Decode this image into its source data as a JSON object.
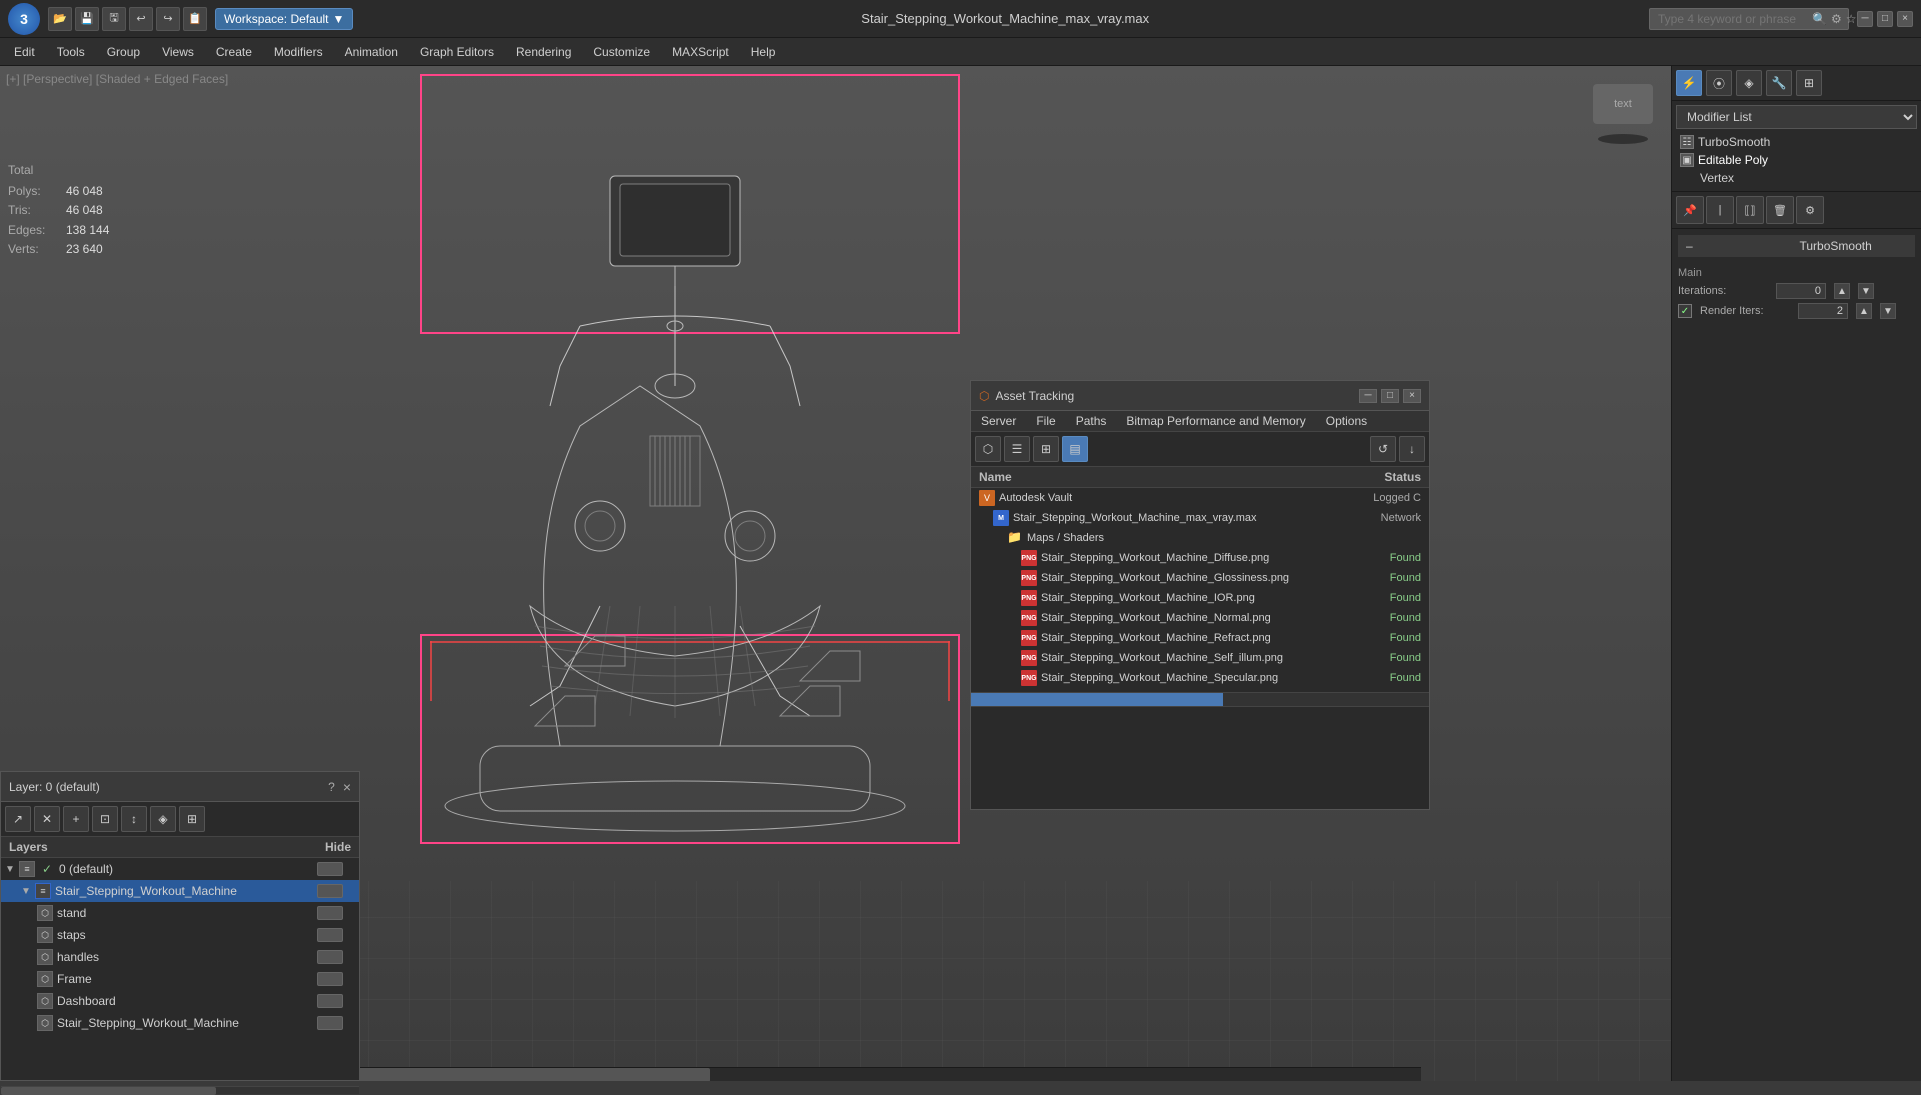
{
  "app": {
    "logo": "3",
    "title": "Stair_Stepping_Workout_Machine_max_vray.max",
    "workspace": "Workspace: Default"
  },
  "toolbar": {
    "buttons": [
      "💾",
      "📂",
      "🖫",
      "↩",
      "↪",
      "📋"
    ],
    "search_placeholder": "Type 4 keyword or phrase",
    "search_icons": [
      "🔍",
      "⚙",
      "★",
      "?"
    ]
  },
  "menu": {
    "items": [
      "Edit",
      "Tools",
      "Group",
      "Views",
      "Create",
      "Modifiers",
      "Animation",
      "Graph Editors",
      "Rendering",
      "Customize",
      "MAXScript",
      "Help"
    ]
  },
  "viewport": {
    "label": "[+] [Perspective] [Shaded + Edged Faces]",
    "stats": {
      "total_label": "Total",
      "polys_label": "Polys:",
      "polys_value": "46 048",
      "tris_label": "Tris:",
      "tris_value": "46 048",
      "edges_label": "Edges:",
      "edges_value": "138 144",
      "verts_label": "Verts:",
      "verts_value": "23 640"
    }
  },
  "right_panel": {
    "modifier_list_label": "Modifier List",
    "turbosmooth_label": "TurboSmooth",
    "editable_poly_label": "Editable Poly",
    "vertex_label": "Vertex",
    "section": {
      "title": "TurboSmooth",
      "main_label": "Main",
      "iterations_label": "Iterations:",
      "iterations_value": "0",
      "render_iters_label": "Render Iters:",
      "render_iters_value": "2"
    }
  },
  "layers_panel": {
    "title": "Layer: 0 (default)",
    "close_btn": "×",
    "help_btn": "?",
    "col_name": "Layers",
    "col_hide": "Hide",
    "items": [
      {
        "indent": 0,
        "name": "0 (default)",
        "type": "layer",
        "check": true,
        "expanded": true
      },
      {
        "indent": 1,
        "name": "Stair_Stepping_Workout_Machine",
        "type": "layer",
        "selected": true,
        "expanded": true
      },
      {
        "indent": 2,
        "name": "stand",
        "type": "object"
      },
      {
        "indent": 2,
        "name": "staps",
        "type": "object"
      },
      {
        "indent": 2,
        "name": "handles",
        "type": "object"
      },
      {
        "indent": 2,
        "name": "Frame",
        "type": "object"
      },
      {
        "indent": 2,
        "name": "Dashboard",
        "type": "object"
      },
      {
        "indent": 2,
        "name": "Stair_Stepping_Workout_Machine",
        "type": "object"
      }
    ]
  },
  "asset_panel": {
    "title": "Asset Tracking",
    "col_name": "Name",
    "col_status": "Status",
    "menu_items": [
      "Server",
      "File",
      "Paths",
      "Bitmap Performance and Memory",
      "Options"
    ],
    "items": [
      {
        "indent": 0,
        "type": "vault",
        "name": "Autodesk Vault",
        "status": "Logged C"
      },
      {
        "indent": 1,
        "type": "max",
        "name": "Stair_Stepping_Workout_Machine_max_vray.max",
        "status": "Network"
      },
      {
        "indent": 2,
        "type": "folder",
        "name": "Maps / Shaders",
        "status": ""
      },
      {
        "indent": 3,
        "type": "png",
        "name": "Stair_Stepping_Workout_Machine_Diffuse.png",
        "status": "Found"
      },
      {
        "indent": 3,
        "type": "png",
        "name": "Stair_Stepping_Workout_Machine_Glossiness.png",
        "status": "Found"
      },
      {
        "indent": 3,
        "type": "png",
        "name": "Stair_Stepping_Workout_Machine_IOR.png",
        "status": "Found"
      },
      {
        "indent": 3,
        "type": "png",
        "name": "Stair_Stepping_Workout_Machine_Normal.png",
        "status": "Found"
      },
      {
        "indent": 3,
        "type": "png",
        "name": "Stair_Stepping_Workout_Machine_Refract.png",
        "status": "Found"
      },
      {
        "indent": 3,
        "type": "png",
        "name": "Stair_Stepping_Workout_Machine_Self_illum.png",
        "status": "Found"
      },
      {
        "indent": 3,
        "type": "png",
        "name": "Stair_Stepping_Workout_Machine_Specular.png",
        "status": "Found"
      }
    ]
  }
}
